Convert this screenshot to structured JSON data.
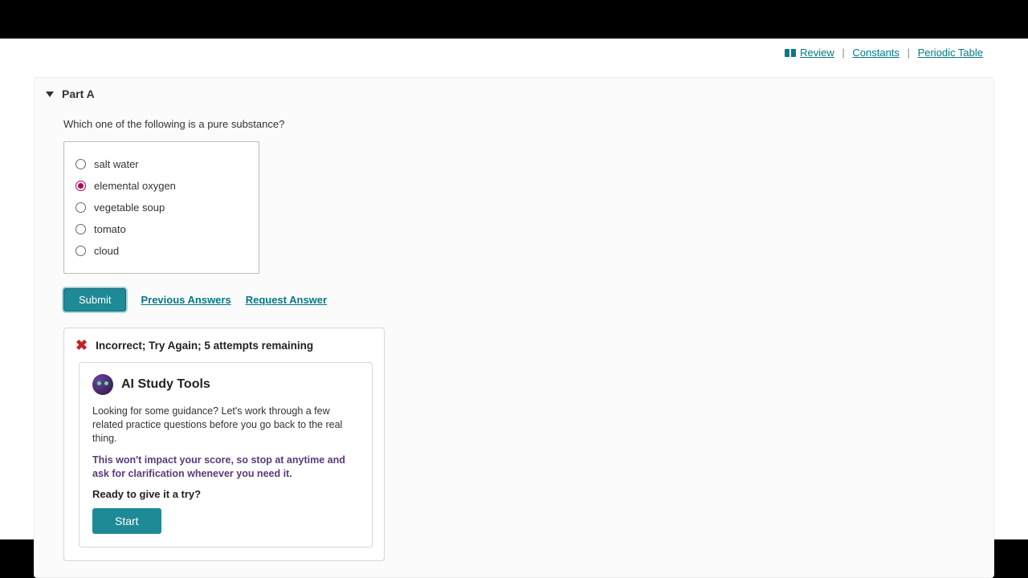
{
  "topnav": {
    "review": "Review",
    "constants": "Constants",
    "periodic": "Periodic Table"
  },
  "part": {
    "title": "Part A",
    "question": "Which one of the following is a pure substance?",
    "options": [
      {
        "label": "salt water",
        "selected": false
      },
      {
        "label": "elemental oxygen",
        "selected": true
      },
      {
        "label": "vegetable soup",
        "selected": false
      },
      {
        "label": "tomato",
        "selected": false
      },
      {
        "label": "cloud",
        "selected": false
      }
    ]
  },
  "actions": {
    "submit": "Submit",
    "previous": "Previous Answers",
    "request": "Request Answer"
  },
  "feedback": {
    "message": "Incorrect; Try Again; 5 attempts remaining"
  },
  "ai": {
    "title": "AI Study Tools",
    "p1": "Looking for some guidance? Let's work through a few related practice questions before you go back to the real thing.",
    "note": "This won't impact your score, so stop at anytime and ask for clarification whenever you need it.",
    "ready": "Ready to give it a try?",
    "start": "Start"
  }
}
